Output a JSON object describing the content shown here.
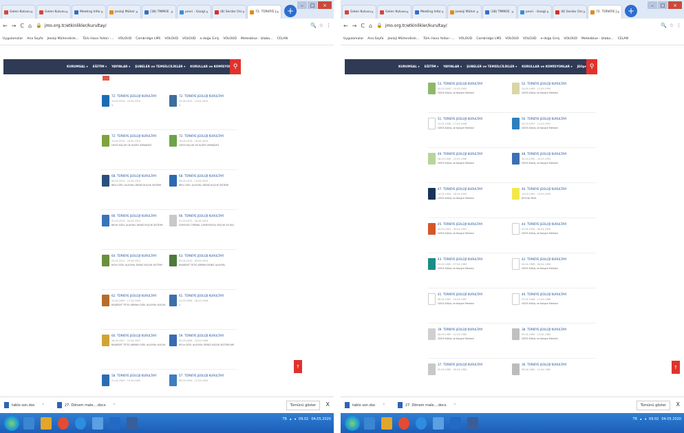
{
  "left": {
    "tabs": [
      {
        "label": "Gelen Kutusu",
        "color": "#d64537"
      },
      {
        "label": "Gelen Kutusu",
        "color": "#d64537"
      },
      {
        "label": "Meeting Infor",
        "color": "#2d6ecf"
      },
      {
        "label": "Jeoloji Müher",
        "color": "#e58a12"
      },
      {
        "label": "(38) TMMOE",
        "color": "#2d6ecf"
      },
      {
        "label": "pevri - Googl",
        "color": "#3b8ae0"
      },
      {
        "label": "(8) Serdar Orc",
        "color": "#d62f28"
      },
      {
        "label": "72. TÜRKİYE J",
        "color": "#e58a12"
      }
    ],
    "url": "jmo.org.tr/etkinlikler/kurultay/",
    "bookmarks": [
      "Uygulamalar",
      "Ana Sayfa",
      "Jeoloji Mühendisle...",
      "Türk Hava Yolları -...",
      "VOLOUD",
      "Cambridge LMS",
      "VOLOUD",
      "VOLOUD",
      "e-doğa Giriş",
      "VOLOUD",
      "Meteoblue - Izlaba...",
      "CELAN"
    ],
    "nav": [
      "KURUMSAL ▾",
      "EĞİTİM ▾",
      "YAYINLAR ▾",
      "ŞUBELER ve TEMSİLCİLİKLER ▾",
      "KURULLAR ve KOMİSYONLAR ▾",
      "JEOpraq"
    ],
    "cards": [
      {
        "title": "72. TÜRKİYE JEOLOJİ KURULTAYI",
        "date": "19.04.2019 - 19.04.2019",
        "desc": "1",
        "cover": "#1c6cb3"
      },
      {
        "title": "72. TÜRKİYE JEOLOJİ KURULTAYI",
        "date": "20.04.2019 - 13.04.2019",
        "desc": "1",
        "cover": "#3c6e9e"
      },
      {
        "title": "72. TÜRKİYE JEOLOJİ KURULTAYI",
        "date": "14.04.2019 - 18.04.2019",
        "desc": "GEOS KÜÇÜK VE KUZEY ARMADEZ",
        "cover": "#7da43d"
      },
      {
        "title": "72. TÜRKİYE JEOLOJİ KURULTAYI",
        "date": "18.04.2019 - 18.04.2019",
        "desc": "GEOS KÜÇÜK VE KUZEY ARMADEZ",
        "cover": "#6aa34a"
      },
      {
        "title": "68. TÜRKİYE JEOLOJİ KURULTAYI",
        "date": "06.04.2015 - 10.04.2015",
        "desc": "68'e ÖZEL ALÜVYAL DENİZ KÜÇÜK SİSTEMİ",
        "cover": "#2a4f7d"
      },
      {
        "title": "68. TÜRKİYE JEOLOJİ KURULTAYI",
        "date": "06.04.2015 - 10.04.2015",
        "desc": "68'e ÖZEL ALÜVYAL DENİZ KÜÇÜK SİSTEMİ",
        "cover": "#2c6ab0"
      },
      {
        "title": "66. TÜRKİYE JEOLOJİ KURULTAYI",
        "date": "31.03.2013 - 04.04.2013",
        "desc": "66'de ÖZEL ALÜVYAL DENİZ KÜÇÜK SİSTEMİ",
        "cover": "#3a73bb"
      },
      {
        "title": "66. TÜRKİYE JEOLOJİ KURULTAYI",
        "date": "31.03.2013 - 04.04.2013",
        "desc": "GÖKYÜZÜ TERNAL GÜNEYDOĞU KÜÇÜK VE KUZEY ARMADEZ",
        "cover": "#c9c9c9"
      },
      {
        "title": "64. TÜRKİYE JEOLOJİ KURULTAYI",
        "date": "25.04.2011 - 29.04.2011",
        "desc": "64'te ÖZEL ALÜVYAL DENİZ KÜÇÜK SİSTEMİ",
        "cover": "#6a8f3e"
      },
      {
        "title": "63. TÜRKİYE JEOLOJİ KURULTAYI",
        "date": "05.04.2010 - 09.04.2010",
        "desc": "BAŞKENT TETİS ARMAN DENİZ ALÜVYAL",
        "cover": "#4e7a3a"
      },
      {
        "title": "62. TÜRKİYE JEOLOJİ KURULTAYI",
        "date": "13.04.2009 - 17.04.2009",
        "desc": "BAŞKENT TETİS ARMAN ÖZEL ALÜVYAL KÜÇÜK SİSTEMİ",
        "cover": "#b66d2a"
      },
      {
        "title": "61. TÜRKİYE JEOLOJİ KURULTAYI",
        "date": "24.03.2008 - 28.03.2008",
        "desc": "1",
        "cover": "#3d70a8"
      },
      {
        "title": "60. TÜRKİYE JEOLOJİ KURULTAYI",
        "date": "16.04.2007 - 22.04.2007",
        "desc": "BAŞKENT TETİS ARMAN ÖZEL ALÜVYAL KÜÇÜK SİSTEMİ ARMADEZ",
        "cover": "#d1a337"
      },
      {
        "title": "59. TÜRKİYE JEOLOJİ KURULTAYI",
        "date": "20.03.2006 - 24.03.2006",
        "desc": "60'ta ÖZEL ALÜVYAL DENİZ KÜÇÜK SİSTEMİ ARMAN",
        "cover": "#3a6ab2"
      },
      {
        "title": "58. TÜRKİYE JEOLOJİ KURULTAYI",
        "date": "11.04.2005 - 15.04.2005",
        "desc": "",
        "cover": "#2b6cb4"
      },
      {
        "title": "57. TÜRKİYE JEOLOJİ KURULTAYI",
        "date": "08.03.2004 - 12.03.2004",
        "desc": "",
        "cover": "#3f7dc0"
      }
    ]
  },
  "right": {
    "tabs": [
      {
        "label": "Gelen Kutusu",
        "color": "#d64537"
      },
      {
        "label": "Gelen Kutusu",
        "color": "#d64537"
      },
      {
        "label": "Meeting Infor",
        "color": "#2d6ecf"
      },
      {
        "label": "Jeoloji Müher",
        "color": "#e58a12"
      },
      {
        "label": "(38) TMMOE",
        "color": "#2d6ecf"
      },
      {
        "label": "pevri - Googl",
        "color": "#3b8ae0"
      },
      {
        "label": "(8) Serdar Orc",
        "color": "#d62f28"
      },
      {
        "label": "72. TÜRKİYE J",
        "color": "#e58a12"
      }
    ],
    "url": "jmo.org.tr/etkinlikler/kurultay/",
    "bookmarks": [
      "Uygulamalar",
      "Ana Sayfa",
      "Jeoloji Mühendisle...",
      "Türk Hava Yolları -...",
      "VOLOUD",
      "Cambridge LMS",
      "VOLOUD",
      "VOLOUD",
      "e-doğa Giriş",
      "VOLOUD",
      "Meteoblue - Izlaba...",
      "CELAN"
    ],
    "nav": [
      "KURUMSAL ▾",
      "EĞİTİM ▾",
      "YAYINLAR ▾",
      "ŞUBELER ve TEMSİLCİLİKLER ▾",
      "KURULLAR ve KOMİSYONLAR ▾",
      "JEOpraq"
    ],
    "cards": [
      {
        "title": "53. TÜRKİYE JEOLOJİ KURULTAYI",
        "date": "05.03.2000 - 10.03.2000",
        "desc": "GEOS Küküç ve Kongre Merkezi",
        "cover": "#8fb86a"
      },
      {
        "title": "52. TÜRKİYE JEOLOJİ KURULTAYI",
        "date": "10.05.1999 - 12.05.1999",
        "desc": "GEOS Küküç ve Kongre Merkezi",
        "cover": "#d9d6a5"
      },
      {
        "title": "51. TÜRKİYE JEOLOJİ KURULTAYI",
        "date": "13.03.1998 - 17.03.1998",
        "desc": "GEOS Küküç ve Kongre Merkezi",
        "cover": "#ffffff"
      },
      {
        "title": "50. TÜRKİYE JEOLOJİ KURULTAYI",
        "date": "15.03.1997 - 21.03.1997",
        "desc": "GEOS Küküç ve Kongre Merkezi",
        "cover": "#2b7fbd"
      },
      {
        "title": "49. TÜRKİYE JEOLOJİ KURULTAYI",
        "date": "18.03.1996 - 22.03.1996",
        "desc": "GEOS Küküç ve Kongre Merkezi",
        "cover": "#b7d59a"
      },
      {
        "title": "48. TÜRKİYE JEOLOJİ KURULTAYI",
        "date": "20.03.1995 - 24.03.1995",
        "desc": "GEOS Küküç ve Kongre Merkezi",
        "cover": "#3d6fb4"
      },
      {
        "title": "47. TÜRKİYE JEOLOJİ KURULTAYI",
        "date": "14.03.1994 - 18.03.1994",
        "desc": "GEOS Küküç ve Kongre Merkezi",
        "cover": "#17335c"
      },
      {
        "title": "46. TÜRKİYE JEOLOJİ KURULTAYI",
        "date": "15.03.1993 - 19.03.1993",
        "desc": "JEOLOJİ MAH.",
        "cover": "#f2e84b"
      },
      {
        "title": "45. TÜRKİYE JEOLOJİ KURULTAYI",
        "date": "30.03.1991 - 05.04.1991",
        "desc": "GEOS Küküç ve Kongre Merkezi",
        "cover": "#d4562b"
      },
      {
        "title": "44. TÜRKİYE JEOLOJİ KURULTAYI",
        "date": "02.04.1990 - 06.04.1990",
        "desc": "GEOS Küküç ve Kongre Merkezi",
        "cover": "#ffffff"
      },
      {
        "title": "43. TÜRKİYE JEOLOJİ KURULTAYI",
        "date": "03.04.1989 - 07.04.1989",
        "desc": "GEOS Küküç ve Kongre Merkezi",
        "cover": "#1a8c86"
      },
      {
        "title": "42. TÜRKİYE JEOLOJİ KURULTAYI",
        "date": "04.04.1988 - 08.04.1988",
        "desc": "GEOS Küküç ve Kongre Merkezi",
        "cover": "#ffffff"
      },
      {
        "title": "41. TÜRKİYE JEOLOJİ KURULTAYI",
        "date": "06.04.1987 - 10.04.1987",
        "desc": "GEOS Küküç ve Kongre Merkezi",
        "cover": "#ffffff"
      },
      {
        "title": "40. TÜRKİYE JEOLOJİ KURULTAYI",
        "date": "07.04.1986 - 11.04.1986",
        "desc": "GEOS Küküç ve Kongre Merkezi",
        "cover": "#ffffff"
      },
      {
        "title": "39. TÜRKİYE JEOLOJİ KURULTAYI",
        "date": "08.04.1985 - 12.04.1985",
        "desc": "GEOS Küküç ve Kongre Merkezi",
        "cover": "#d0d0d0"
      },
      {
        "title": "38. TÜRKİYE JEOLOJİ KURULTAYI",
        "date": "09.04.1984 - 13.04.1984",
        "desc": "GEOS Küküç ve Kongre Merkezi",
        "cover": "#c0c0c0"
      },
      {
        "title": "37. TÜRKİYE JEOLOJİ KURULTAYI",
        "date": "05.04.1983 - 09.04.1983",
        "desc": "",
        "cover": "#c8c8c8"
      },
      {
        "title": "36. TÜRKİYE JEOLOJİ KURULTAYI",
        "date": "06.04.1982 - 10.04.1982",
        "desc": "",
        "cover": "#bcbcbc"
      }
    ]
  },
  "downloads": [
    {
      "name": "tablo son.doc"
    },
    {
      "name": "27. Dönem male....docx"
    }
  ],
  "downloads_show_all": "Tümünü göster",
  "tray": {
    "lang": "TR",
    "time": "09.02",
    "date": "04.05.2020"
  }
}
